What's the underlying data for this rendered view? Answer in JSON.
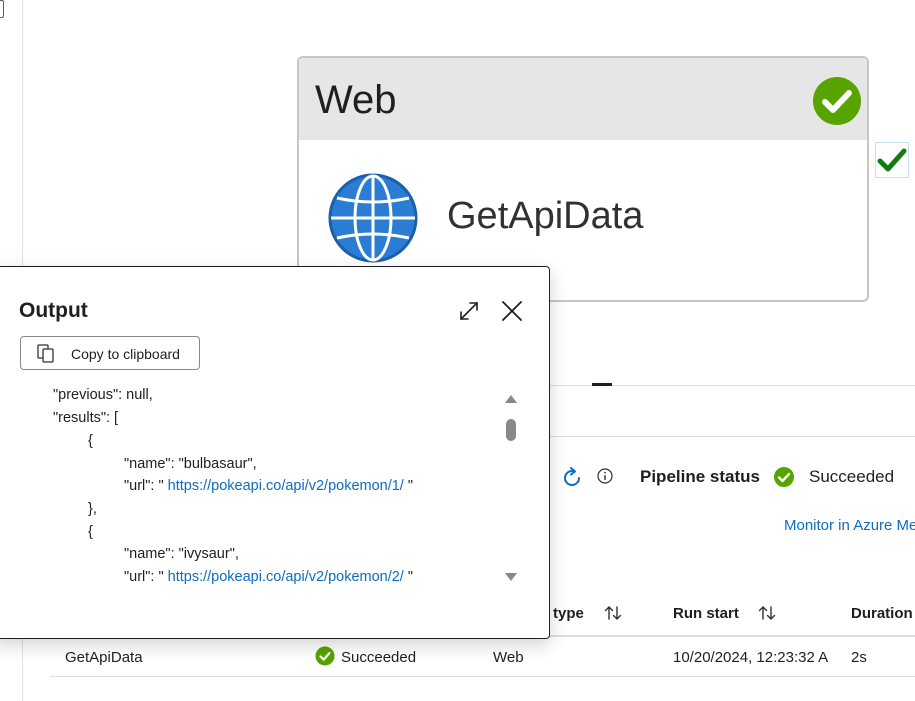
{
  "colors": {
    "success": "#57a300",
    "link": "#0f6cbd",
    "globe": "#2b7cd3",
    "card_header": "#e6e6e6"
  },
  "activity": {
    "type": "Web",
    "name": "GetApiData",
    "status_icon": "check-circle-icon",
    "activity_icon": "globe-icon"
  },
  "pipeline": {
    "status_label": "Pipeline status",
    "status_value": "Succeeded",
    "monitor_link": "Monitor in Azure Me",
    "columns": [
      "type",
      "Run start",
      "Duration"
    ],
    "rows": [
      {
        "name": "GetApiData",
        "status": "Succeeded",
        "type": "Web",
        "run_start": "10/20/2024, 12:23:32 A",
        "duration": "2s"
      }
    ]
  },
  "output_dialog": {
    "title": "Output",
    "copy_button": "Copy to clipboard",
    "lines": [
      {
        "text": "\"previous\": null,",
        "link": ""
      },
      {
        "text": "\"results\": [",
        "link": ""
      },
      {
        "text": "{",
        "link": ""
      },
      {
        "text": "\"name\": \"bulbasaur\",",
        "link": ""
      },
      {
        "text": "\"url\": \" ",
        "link": "https://pokeapi.co/api/v2/pokemon/1/",
        "tail": " \""
      },
      {
        "text": "},",
        "link": ""
      },
      {
        "text": "{",
        "link": ""
      },
      {
        "text": "\"name\": \"ivysaur\",",
        "link": ""
      },
      {
        "text": "\"url\": \" ",
        "link": "https://pokeapi.co/api/v2/pokemon/2/",
        "tail": " \""
      },
      {
        "text": "}",
        "link": ""
      }
    ]
  }
}
